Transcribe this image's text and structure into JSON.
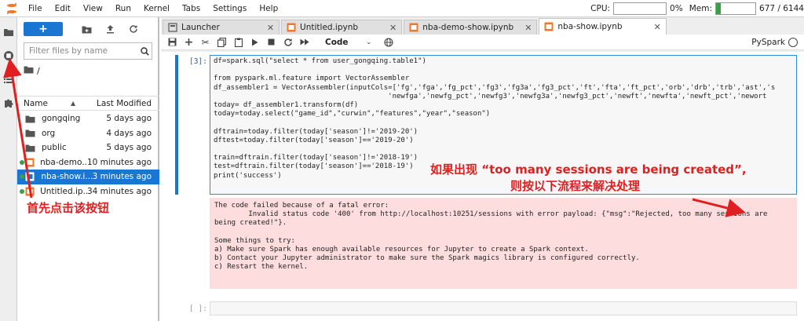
{
  "menu": [
    "File",
    "Edit",
    "View",
    "Run",
    "Kernel",
    "Tabs",
    "Settings",
    "Help"
  ],
  "resources": {
    "cpu_label": "CPU:",
    "cpu_value": "0%",
    "mem_label": "Mem:",
    "mem_value": "677 / 6144",
    "mem_fraction": 0.11,
    "mem_color": "#3aa047"
  },
  "filebrowser": {
    "new_button": "+",
    "filter_placeholder": "Filter files by name",
    "breadcrumb": "/",
    "col_name": "Name",
    "col_modified": "Last Modified",
    "files": [
      {
        "name": "gongqing",
        "modified": "5 days ago",
        "type": "folder",
        "running": false,
        "selected": false
      },
      {
        "name": "org",
        "modified": "4 days ago",
        "type": "folder",
        "running": false,
        "selected": false
      },
      {
        "name": "public",
        "modified": "5 days ago",
        "type": "folder",
        "running": false,
        "selected": false
      },
      {
        "name": "nba-demo...",
        "modified": "10 minutes ago",
        "type": "notebook",
        "running": true,
        "selected": false
      },
      {
        "name": "nba-show.i...",
        "modified": "3 minutes ago",
        "type": "notebook",
        "running": true,
        "selected": true
      },
      {
        "name": "Untitled.ip...",
        "modified": "34 minutes ago",
        "type": "notebook",
        "running": true,
        "selected": false
      }
    ]
  },
  "tabs": [
    {
      "label": "Launcher",
      "icon": "launcher-icon",
      "active": false
    },
    {
      "label": "Untitled.ipynb",
      "icon": "notebook-icon",
      "active": false
    },
    {
      "label": "nba-demo-show.ipynb",
      "icon": "notebook-icon",
      "active": false
    },
    {
      "label": "nba-show.ipynb",
      "icon": "notebook-icon",
      "active": true
    }
  ],
  "toolbar": {
    "cell_type": "Code",
    "kernel": "PySpark"
  },
  "cell1": {
    "prompt": "[3]:",
    "code_lines": [
      "df=spark.sql(\"select * from user_gongqing.table1\")",
      "",
      "from pyspark.ml.feature import VectorAssembler",
      "df_assembler1 = VectorAssembler(inputCols=['fg','fga','fg_pct','fg3','fg3a','fg3_pct','ft','fta','ft_pct','orb','drb','trb','ast','s",
      "                                         'newfga','newfg_pct','newfg3','newfg3a','newfg3_pct','newft','newfta','newft_pct','newort",
      "today= df_assembler1.transform(df)",
      "today=today.select(\"game_id\",\"curwin\",\"features\",\"year\",\"season\")",
      "",
      "dftrain=today.filter(today['season']!='2019-20')",
      "dftest=today.filter(today['season']=='2019-20')",
      "",
      "train=dftrain.filter(today['season']!='2018-19')",
      "test=dftrain.filter(today['season']=='2018-19')",
      "print('success')"
    ]
  },
  "output1": {
    "lines": [
      "The code failed because of a fatal error:",
      "        Invalid status code '400' from http://localhost:10251/sessions with error payload: {\"msg\":\"Rejected, too many sessions are",
      "being created!\"}.",
      "",
      "Some things to try:",
      "a) Make sure Spark has enough available resources for Jupyter to create a Spark context.",
      "b) Contact your Jupyter administrator to make sure the Spark magics library is configured correctly.",
      "c) Restart the kernel."
    ]
  },
  "cell2": {
    "prompt": "[ ]:"
  },
  "annotations": {
    "left": "首先点击该按钮",
    "right_1": "如果出现 “too many sessions are being created”,",
    "right_2": "则按以下流程来解决处理",
    "color": "#e02020"
  }
}
